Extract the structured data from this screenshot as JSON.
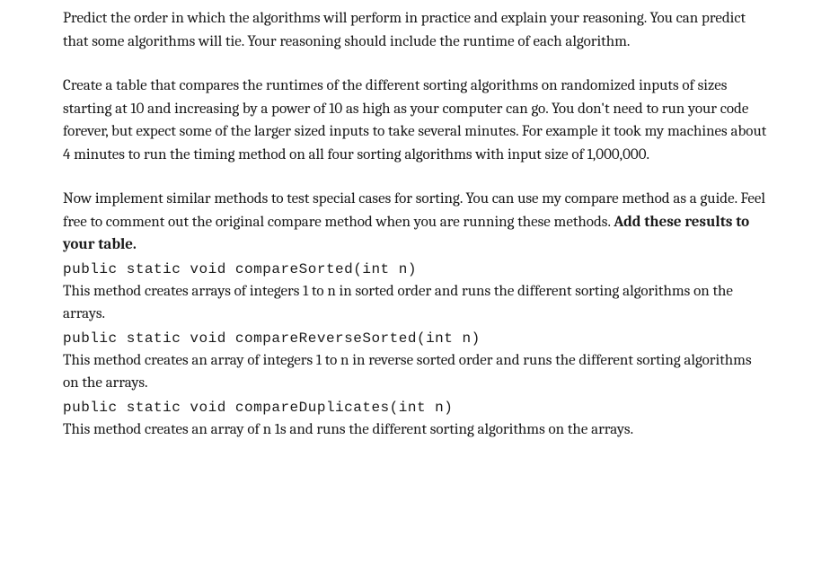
{
  "paragraphs": {
    "p1": "Predict the order in which the algorithms will perform in practice and explain your reasoning. You can predict that some algorithms will tie. Your reasoning should include the runtime of each algorithm.",
    "p2": "Create a table that compares the runtimes of the different sorting algorithms on randomized inputs of sizes starting at 10 and increasing by a power of 10 as high as your computer can go. You don't need to run your code forever, but expect some of the larger sized inputs to take several minutes. For example it took my machines about 4 minutes to run the timing method on all four sorting algorithms with input size of 1,000,000.",
    "p3_a": "Now implement similar methods to test special cases for sorting. You can use my compare method as a guide. Feel free to comment out the original compare method when you are running these methods. ",
    "p3_b_bold": "Add these results to your table."
  },
  "methods": {
    "m1": {
      "signature": "public static void compareSorted(int n)",
      "description": "This method creates arrays of integers 1 to n in sorted order and runs the different sorting algorithms on the arrays."
    },
    "m2": {
      "signature": "public static void compareReverseSorted(int n)",
      "description": "This method creates an array of integers 1 to n in reverse sorted order and runs the different sorting algorithms on the arrays."
    },
    "m3": {
      "signature": "public static void compareDuplicates(int n)",
      "description": "This method creates an array of n 1s and runs the different sorting algorithms on the arrays."
    }
  }
}
